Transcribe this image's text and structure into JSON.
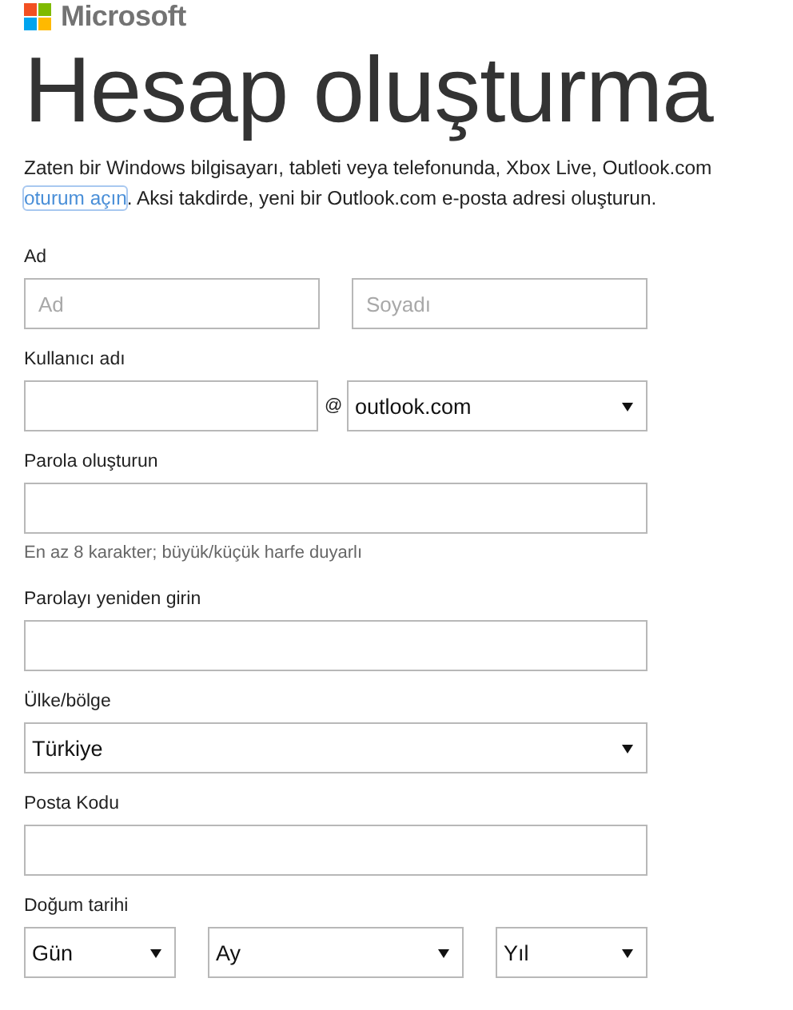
{
  "brand": {
    "name": "Microsoft"
  },
  "title": "Hesap oluşturma",
  "intro": {
    "line1": "Zaten bir Windows bilgisayarı, tableti veya telefonunda, Xbox Live, Outlook.com",
    "link": "oturum açın",
    "line2": ". Aksi takdirde, yeni bir Outlook.com e-posta adresi oluşturun."
  },
  "sections": [
    {
      "kind": "name_pair",
      "label": "Ad",
      "controls": [
        {
          "kind": "input",
          "placeholder": "Ad"
        },
        {
          "kind": "input",
          "placeholder": "Soyadı"
        }
      ]
    },
    {
      "kind": "username",
      "label": "Kullanıcı adı",
      "separator": "@",
      "controls": [
        {
          "kind": "input"
        },
        {
          "kind": "select",
          "value": "outlook.com"
        }
      ]
    },
    {
      "kind": "single",
      "label": "Parola oluşturun",
      "hint": "En az 8 karakter; büyük/küçük harfe duyarlı",
      "controls": [
        {
          "kind": "input"
        }
      ]
    },
    {
      "kind": "single",
      "label": "Parolayı yeniden girin",
      "controls": [
        {
          "kind": "input"
        }
      ]
    },
    {
      "kind": "single",
      "label": "Ülke/bölge",
      "controls": [
        {
          "kind": "select",
          "value": "Türkiye"
        }
      ]
    },
    {
      "kind": "single",
      "label": "Posta Kodu",
      "controls": [
        {
          "kind": "input"
        }
      ]
    },
    {
      "kind": "date",
      "label": "Doğum tarihi",
      "controls": [
        {
          "kind": "select",
          "value": "Gün"
        },
        {
          "kind": "select",
          "value": "Ay"
        },
        {
          "kind": "select",
          "value": "Yıl"
        }
      ]
    }
  ]
}
